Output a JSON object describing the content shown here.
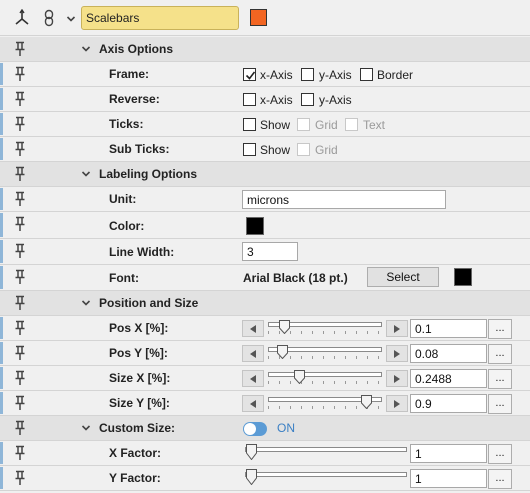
{
  "header": {
    "title": "Scalebars",
    "color": "#f26522"
  },
  "axis": {
    "section": "Axis Options",
    "frame": {
      "label": "Frame:",
      "opts": [
        "x-Axis",
        "y-Axis",
        "Border"
      ],
      "checked": [
        true,
        false,
        false
      ]
    },
    "reverse": {
      "label": "Reverse:",
      "opts": [
        "x-Axis",
        "y-Axis"
      ],
      "checked": [
        false,
        false
      ]
    },
    "ticks": {
      "label": "Ticks:",
      "opts": [
        "Show",
        "Grid",
        "Text"
      ],
      "checked": [
        false,
        false,
        false
      ]
    },
    "subticks": {
      "label": "Sub Ticks:",
      "opts": [
        "Show",
        "Grid"
      ],
      "checked": [
        false,
        false
      ]
    }
  },
  "labeling": {
    "section": "Labeling Options",
    "unit": {
      "label": "Unit:",
      "value": "microns"
    },
    "color": {
      "label": "Color:",
      "value": "#000000"
    },
    "linewidth": {
      "label": "Line Width:",
      "value": "3"
    },
    "font": {
      "label": "Font:",
      "value": "Arial Black (18 pt.)",
      "button": "Select",
      "color": "#000000"
    }
  },
  "position": {
    "section": "Position and Size",
    "rows": [
      {
        "label": "Pos X [%]:",
        "value": "0.1",
        "level": 0.1,
        "more": "..."
      },
      {
        "label": "Pos Y [%]:",
        "value": "0.08",
        "level": 0.08,
        "more": "..."
      },
      {
        "label": "Size X [%]:",
        "value": "0.2488",
        "level": 0.2488,
        "more": "..."
      },
      {
        "label": "Size Y [%]:",
        "value": "0.9",
        "level": 0.9,
        "more": "..."
      }
    ]
  },
  "custom": {
    "section": "Custom Size:",
    "toggle_label": "ON",
    "toggle_on": true,
    "rows": [
      {
        "label": "X Factor:",
        "value": "1",
        "more": "..."
      },
      {
        "label": "Y Factor:",
        "value": "1",
        "more": "..."
      }
    ]
  },
  "icons": {
    "axes": "axes-icon",
    "link": "link-icon",
    "pin": "pin-icon",
    "chevron": "chevron-down-icon",
    "checkmark": "checkmark-icon",
    "arrow_left": "arrow-left-icon",
    "arrow_right": "arrow-right-icon"
  }
}
